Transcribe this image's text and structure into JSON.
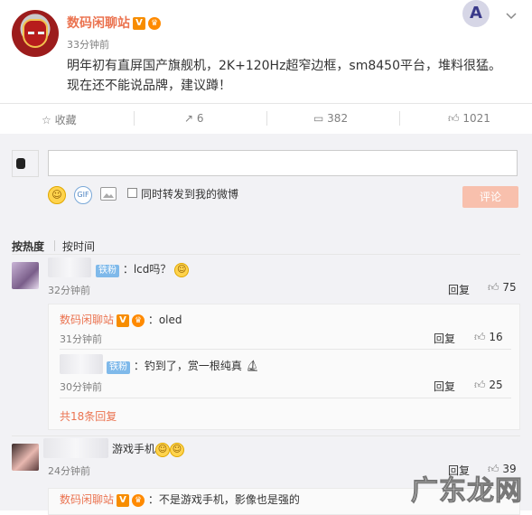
{
  "post": {
    "author": "数码闲聊站",
    "verified_badge": "V",
    "time": "33分钟前",
    "text": "明年初有直屏国产旗舰机，2K+120Hz超窄边框，sm8450平台，堆料很猛。现在还不能说品牌，建议蹲！"
  },
  "actions": {
    "favorite": "收藏",
    "repost": "6",
    "comment": "382",
    "like": "1021"
  },
  "composer": {
    "placeholder": "",
    "also_repost": "同时转发到我的微博",
    "submit": "评论",
    "emoji_icon": "smile-icon",
    "gif_icon": "gif-icon",
    "image_icon": "image-icon"
  },
  "sort": {
    "by_hot": "按热度",
    "by_time": "按时间"
  },
  "comments": [
    {
      "badge": "铁粉",
      "text": "：lcd吗？",
      "time": "32分钟前",
      "reply_label": "回复",
      "likes": "75",
      "replies": [
        {
          "author": "数码闲聊站",
          "badge": "V",
          "text": "：oled",
          "time": "31分钟前",
          "reply_label": "回复",
          "likes": "16"
        },
        {
          "badge": "铁粉",
          "text": "：钓到了，赏一根纯真",
          "time": "30分钟前",
          "reply_label": "回复",
          "likes": "25"
        }
      ],
      "more": "共18条回复"
    },
    {
      "text": "游戏手机",
      "time": "24分钟前",
      "reply_label": "回复",
      "likes": "39",
      "replies": [
        {
          "author": "数码闲聊站",
          "badge": "V",
          "text": "：不是游戏手机，影像也是强的"
        }
      ]
    }
  ],
  "watermark": "广东龙网"
}
